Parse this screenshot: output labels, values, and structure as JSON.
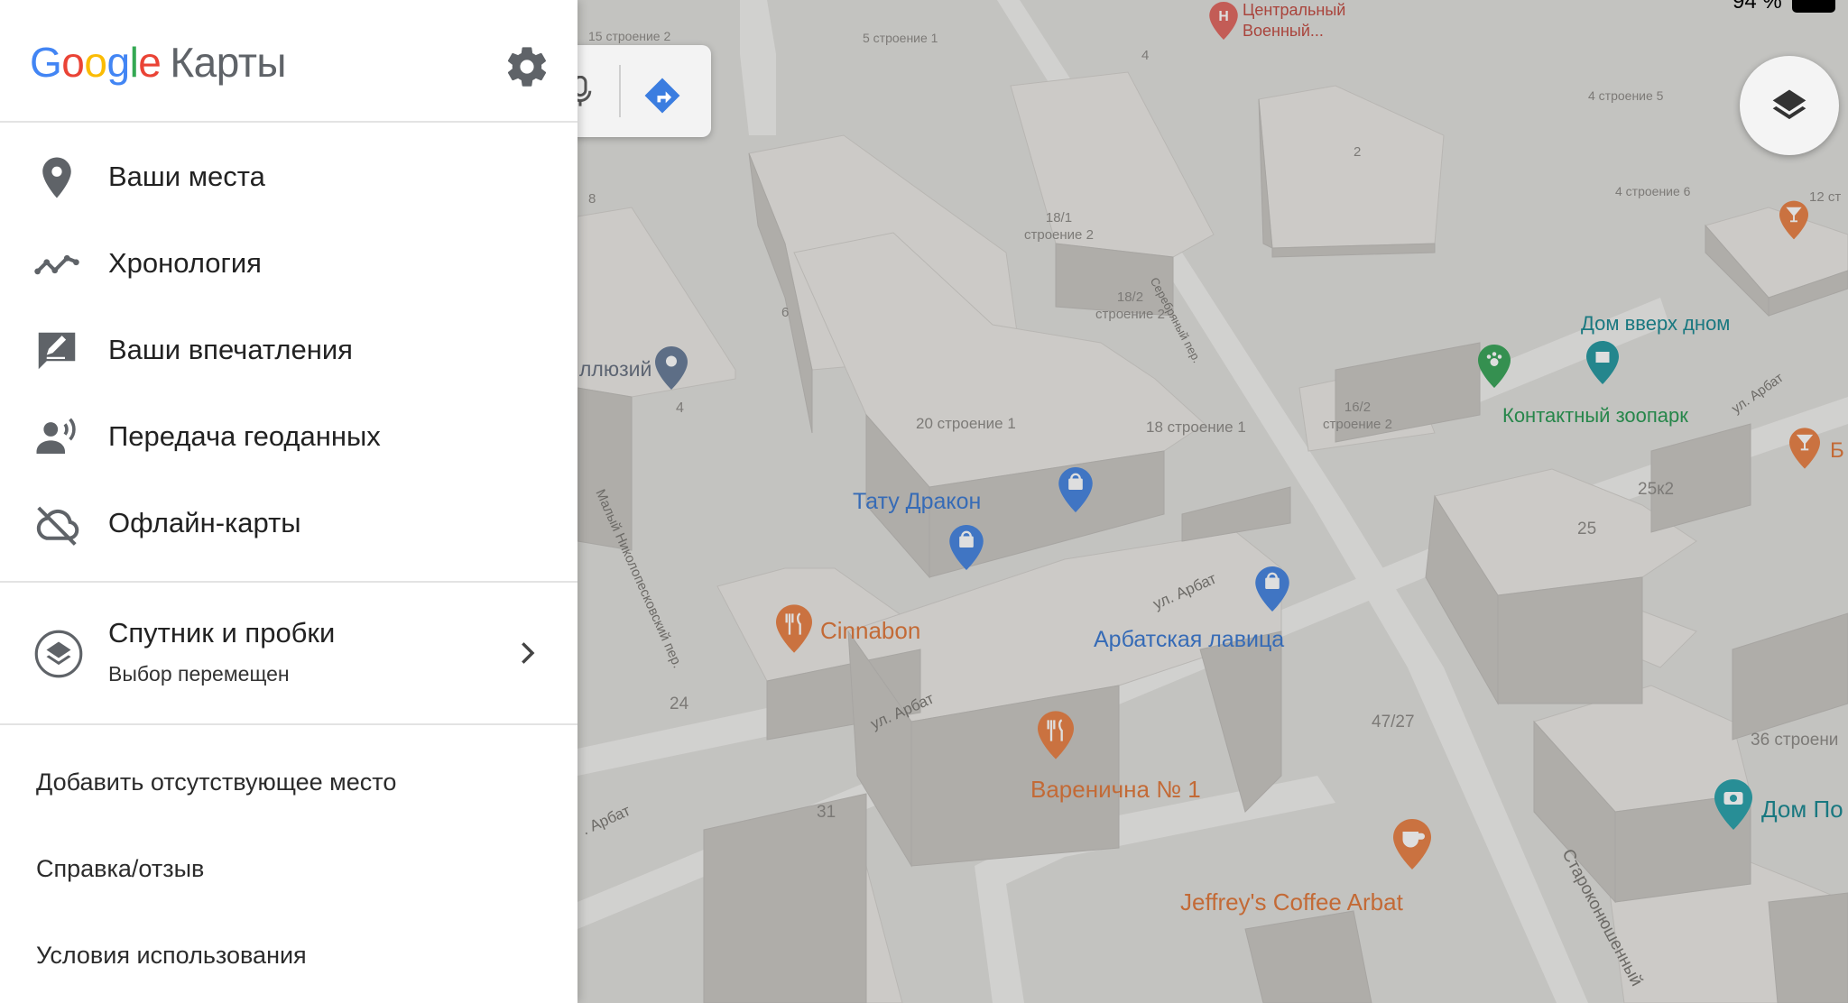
{
  "status_bar": {
    "battery_text": "94 %"
  },
  "drawer": {
    "logo_google": [
      "G",
      "o",
      "o",
      "g",
      "l",
      "e"
    ],
    "logo_product": "Карты",
    "menu": [
      {
        "label": "Ваши места",
        "icon": "place-pin-icon"
      },
      {
        "label": "Хронология",
        "icon": "timeline-icon"
      },
      {
        "label": "Ваши впечатления",
        "icon": "review-icon"
      },
      {
        "label": "Передача геоданных",
        "icon": "location-sharing-icon"
      },
      {
        "label": "Офлайн-карты",
        "icon": "offline-cloud-icon"
      }
    ],
    "layer_item": {
      "title": "Спутник и пробки",
      "subtitle": "Выбор перемещен",
      "icon": "layers-icon"
    },
    "links": [
      "Добавить отсутствующее место",
      "Справка/отзыв",
      "Условия использования"
    ]
  },
  "map": {
    "building_numbers": [
      "15 строение 2",
      "5 строение 1",
      "4",
      "4 строение 5",
      "2",
      "4 строение 6",
      "12 ст",
      "8",
      "6",
      "4",
      "24",
      "31",
      "20 строение 1",
      "18 строение 1",
      "25к2",
      "25",
      "47/27",
      "36 строени"
    ],
    "building_numbers_two_line": [
      {
        "line1": "18/1",
        "line2": "строение 2"
      },
      {
        "line1": "18/2",
        "line2": "строение 2"
      },
      {
        "line1": "16/2",
        "line2": "строение 2"
      }
    ],
    "streets": [
      "Серебряный пер.",
      "Малый Николопесковский пер.",
      "ул. Арбат",
      "ул. Арбат",
      "ул. Арбат",
      ". Арбат",
      "Староконюшенный"
    ],
    "pois": {
      "hospital": {
        "line1": "Центральный",
        "line2": "Военный..."
      },
      "illusion": "ллюзий",
      "tattoo": "Тату Дракон",
      "cinnabon": "Cinnabon",
      "arbat_shop": "Арбатская лавица",
      "varenichnaya": "Варенична № 1",
      "coffee": "Jeffrey's Coffee Arbat",
      "upside_house": "Дом вверх дном",
      "zoo": "Контактный зоопарк",
      "dom_right": "Дом По",
      "bar_right": "Б"
    }
  },
  "colors": {
    "accent_blue": "#4285f4",
    "poi_blue": "#3f7bd2",
    "poi_orange": "#e07a3e",
    "poi_green": "#2c9a55",
    "poi_teal": "#1d8a93"
  }
}
